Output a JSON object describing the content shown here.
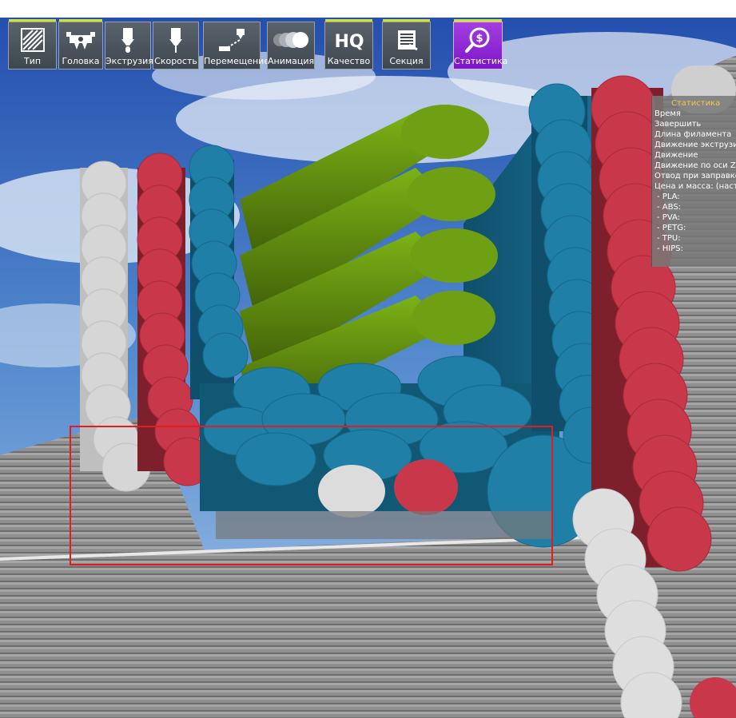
{
  "toolbar": {
    "buttons": [
      {
        "label": "Тип",
        "icon": "layer-type-icon"
      },
      {
        "label": "Головка",
        "icon": "printhead-icon"
      },
      {
        "label": "Экструзия",
        "icon": "extrusion-icon"
      },
      {
        "label": "Скорость",
        "icon": "speed-nozzle-icon"
      },
      {
        "label": "Перемещение",
        "icon": "travel-move-icon"
      },
      {
        "label": "Анимация",
        "icon": "animation-icon"
      },
      {
        "label": "Качество",
        "icon": "hq-icon"
      },
      {
        "label": "Секция",
        "icon": "section-icon"
      },
      {
        "label": "Статистика",
        "icon": "statistics-dollar-icon"
      }
    ],
    "active_index": 8,
    "active_color": "#8b22d4",
    "indicator_color": "#cfe32e"
  },
  "stats": {
    "title": "Статистика",
    "rows": [
      "Время",
      "Завершить",
      "Длина филамента",
      "Движение экструзии",
      "Движение",
      "Движение по оси Z",
      "Отвод при заправке",
      "Цена и масса: (настр"
    ],
    "materials": [
      "- PLA:",
      "- ABS:",
      "- PVA:",
      "- PETG:",
      "- TPU:",
      "- HIPS:"
    ]
  },
  "scene": {
    "colors": {
      "sky_top": "#2b5fbf",
      "sky_bottom": "#9fc2e8",
      "gray_wall": "#8c8c8c",
      "white_extrusion": "#d9d9d9",
      "red_extrusion": "#c8384a",
      "blue_extrusion": "#1f7fa6",
      "green_extrusion": "#6f9f12"
    },
    "selection_color": "#e01e1e"
  }
}
